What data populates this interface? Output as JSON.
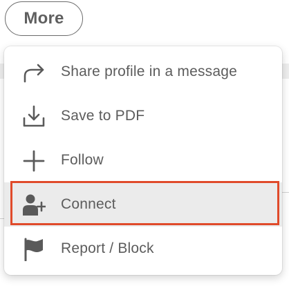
{
  "more_button": {
    "label": "More"
  },
  "menu": {
    "items": [
      {
        "label": "Share profile in a message",
        "icon": "share-arrow-icon"
      },
      {
        "label": "Save to PDF",
        "icon": "download-icon"
      },
      {
        "label": "Follow",
        "icon": "plus-icon"
      },
      {
        "label": "Connect",
        "icon": "add-person-icon",
        "highlighted": true
      },
      {
        "label": "Report / Block",
        "icon": "flag-icon"
      }
    ]
  },
  "colors": {
    "highlight_border": "#e04a2a",
    "highlight_bg": "#ebebeb",
    "text": "#5c5c5c"
  }
}
